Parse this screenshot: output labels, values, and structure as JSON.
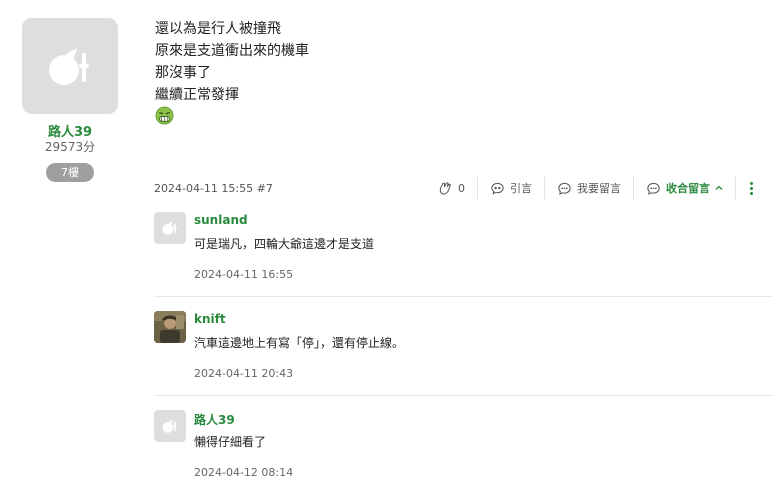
{
  "author": {
    "name": "路人39",
    "points": "29573分",
    "floor": "7樓"
  },
  "post": {
    "lines": [
      "還以為是行人被撞飛",
      "原來是支道衝出來的機車",
      "那沒事了",
      "繼續正常發揮"
    ],
    "emoji": "nauseated-face-icon"
  },
  "meta": {
    "time": "2024-04-11 15:55 #7",
    "like_count": "0",
    "quote_label": "引言",
    "reply_label": "我要留言",
    "collapse_label": "收合留言"
  },
  "comments": [
    {
      "name": "sunland",
      "text": "可是瑞凡，四輪大爺這邊才是支道",
      "time": "2024-04-11 16:55",
      "avatar": "default"
    },
    {
      "name": "knift",
      "text": "汽車這邊地上有寫「停」，還有停止線。",
      "time": "2024-04-11 20:43",
      "avatar": "photo"
    },
    {
      "name": "路人39",
      "text": "懶得仔細看了",
      "time": "2024-04-12 08:14",
      "avatar": "default"
    }
  ],
  "colors": {
    "accent": "#2a8a3c",
    "badge": "#9e9e9e",
    "avatar_bg": "#dedede"
  }
}
